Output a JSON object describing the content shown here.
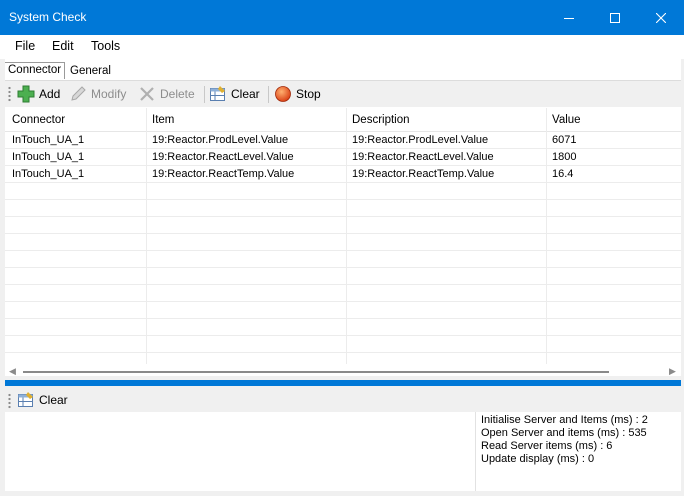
{
  "window": {
    "title": "System Check"
  },
  "menu": [
    "File",
    "Edit",
    "Tools"
  ],
  "tabs": [
    "Connector",
    "General"
  ],
  "toolbar": {
    "add": "Add",
    "modify": "Modify",
    "delete": "Delete",
    "clear": "Clear",
    "stop": "Stop"
  },
  "grid": {
    "columns": [
      "Connector",
      "Item",
      "Description",
      "Value"
    ],
    "rows": [
      [
        "InTouch_UA_1",
        "19:Reactor.ProdLevel.Value",
        "19:Reactor.ProdLevel.Value",
        "6071"
      ],
      [
        "InTouch_UA_1",
        "19:Reactor.ReactLevel.Value",
        "19:Reactor.ReactLevel.Value",
        "1800"
      ],
      [
        "InTouch_UA_1",
        "19:Reactor.ReactTemp.Value",
        "19:Reactor.ReactTemp.Value",
        "16.4"
      ]
    ]
  },
  "log_toolbar": {
    "clear": "Clear"
  },
  "stats": [
    "Initialise Server and Items (ms) : 2",
    "Open Server and items (ms) : 535",
    "Read Server items (ms) : 6",
    "Update display (ms) : 0"
  ],
  "colors": {
    "accent": "#0078d7",
    "toolbar_bg": "#f0f0f0"
  }
}
